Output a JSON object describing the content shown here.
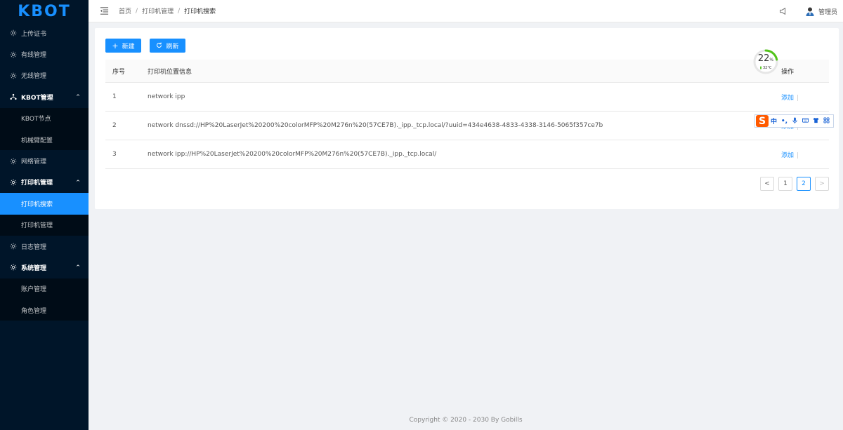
{
  "brand": {
    "logo_text": "KBOT",
    "brand_color": "#1890ff",
    "sidebar_bg": "#001529"
  },
  "sidebar": {
    "items": [
      {
        "label": "上传证书",
        "icon": "gear-icon",
        "type": "item"
      },
      {
        "label": "有线管理",
        "icon": "gear-icon",
        "type": "item"
      },
      {
        "label": "无线管理",
        "icon": "gear-icon",
        "type": "item"
      },
      {
        "label": "KBOT管理",
        "icon": "cluster-icon",
        "type": "parent",
        "caret": "^"
      },
      {
        "label": "KBOT节点",
        "type": "sub"
      },
      {
        "label": "机械臂配置",
        "type": "sub"
      },
      {
        "label": "网络管理",
        "icon": "gear-icon",
        "type": "item"
      },
      {
        "label": "打印机管理",
        "icon": "gear-icon",
        "type": "parent",
        "caret": "^"
      },
      {
        "label": "打印机搜索",
        "type": "sub",
        "active": true
      },
      {
        "label": "打印机管理",
        "type": "sub"
      },
      {
        "label": "日志管理",
        "icon": "gear-icon",
        "type": "item"
      },
      {
        "label": "系统管理",
        "icon": "gear-icon",
        "type": "parent",
        "caret": "^"
      },
      {
        "label": "账户管理",
        "type": "sub"
      },
      {
        "label": "角色管理",
        "type": "sub"
      }
    ]
  },
  "header": {
    "fold_icon": "menu-fold-icon",
    "breadcrumb": [
      "首页",
      "打印机管理",
      "打印机搜索"
    ],
    "separator": "/",
    "notification_icon": "notification-icon",
    "username": "管理员"
  },
  "toolbar": {
    "new_label": "新建",
    "new_icon": "+",
    "refresh_label": "刷新",
    "refresh_icon": "⟳"
  },
  "table": {
    "columns": [
      "序号",
      "打印机位置信息",
      "操作"
    ],
    "rows": [
      {
        "no": "1",
        "info": "network ipp",
        "action": "添加"
      },
      {
        "no": "2",
        "info": "network dnssd://HP%20LaserJet%20200%20colorMFP%20M276n%20(57CE7B)._ipp._tcp.local/?uuid=434e4638-4833-4338-3146-5065f357ce7b",
        "action": "添加"
      },
      {
        "no": "3",
        "info": "network ipp://HP%20LaserJet%20200%20colorMFP%20M276n%20(57CE7B)._ipp._tcp.local/",
        "action": "添加"
      }
    ]
  },
  "pagination": {
    "prev": "<",
    "pages": [
      "1",
      "2"
    ],
    "current": "2",
    "next": ">"
  },
  "gauge": {
    "percent": "22",
    "unit": "%",
    "temperature": "32°C",
    "level": 0.22,
    "color": "#52c41a"
  },
  "ime": {
    "logo": "S",
    "items": [
      "中",
      "•,",
      "🎤",
      "⌨",
      "👕",
      "▦"
    ]
  },
  "footer": {
    "text": "Copyright © 2020 - 2030 By Gobills"
  }
}
